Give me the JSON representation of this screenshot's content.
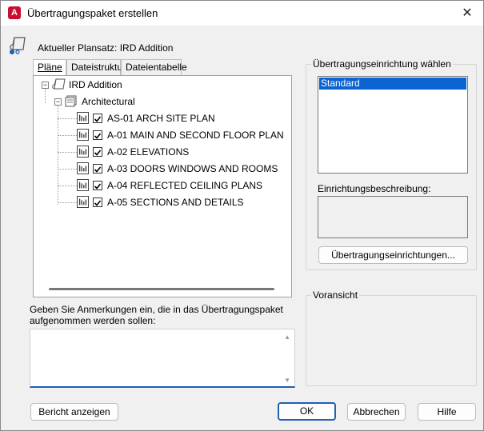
{
  "window": {
    "title": "Übertragungspaket erstellen",
    "app_icon_letter": "A",
    "close_symbol": "✕"
  },
  "current_sheet_set": "Aktueller Plansatz: IRD Addition",
  "tabs": [
    {
      "label": "Pläne",
      "active": true
    },
    {
      "label": "Dateistruktur",
      "active": false
    },
    {
      "label": "Dateientabelle",
      "active": false
    }
  ],
  "tree": {
    "root": {
      "label": "IRD Addition",
      "icon": "sheet-set-icon",
      "expanded": true
    },
    "subset": {
      "label": "Architectural",
      "icon": "subset-icon",
      "expanded": true
    },
    "sheets": [
      {
        "label": "AS-01 ARCH SITE PLAN",
        "checked": true
      },
      {
        "label": "A-01 MAIN AND SECOND FLOOR PLAN",
        "checked": true
      },
      {
        "label": "A-02 ELEVATIONS",
        "checked": true
      },
      {
        "label": "A-03 DOORS WINDOWS AND ROOMS",
        "checked": true
      },
      {
        "label": "A-04 REFLECTED CEILING PLANS",
        "checked": true
      },
      {
        "label": "A-05 SECTIONS AND DETAILS",
        "checked": true
      }
    ]
  },
  "notes": {
    "label_line1": "Geben Sie Anmerkungen ein, die in das Übertragungspaket",
    "label_line2": "aufgenommen werden sollen:",
    "value": ""
  },
  "transmittal_setups": {
    "group_title": "Übertragungseinrichtung wählen",
    "items": [
      "Standard"
    ],
    "selected": "Standard",
    "description_label": "Einrichtungsbeschreibung:",
    "description_value": "",
    "setups_button": "Übertragungseinrichtungen..."
  },
  "preview": {
    "group_title": "Voransicht"
  },
  "buttons": {
    "view_report": "Bericht anzeigen",
    "ok": "OK",
    "cancel": "Abbrechen",
    "help": "Hilfe"
  },
  "colors": {
    "selection": "#0a64d2",
    "focus_border": "#1f5fb4",
    "app_icon": "#c8102e"
  }
}
